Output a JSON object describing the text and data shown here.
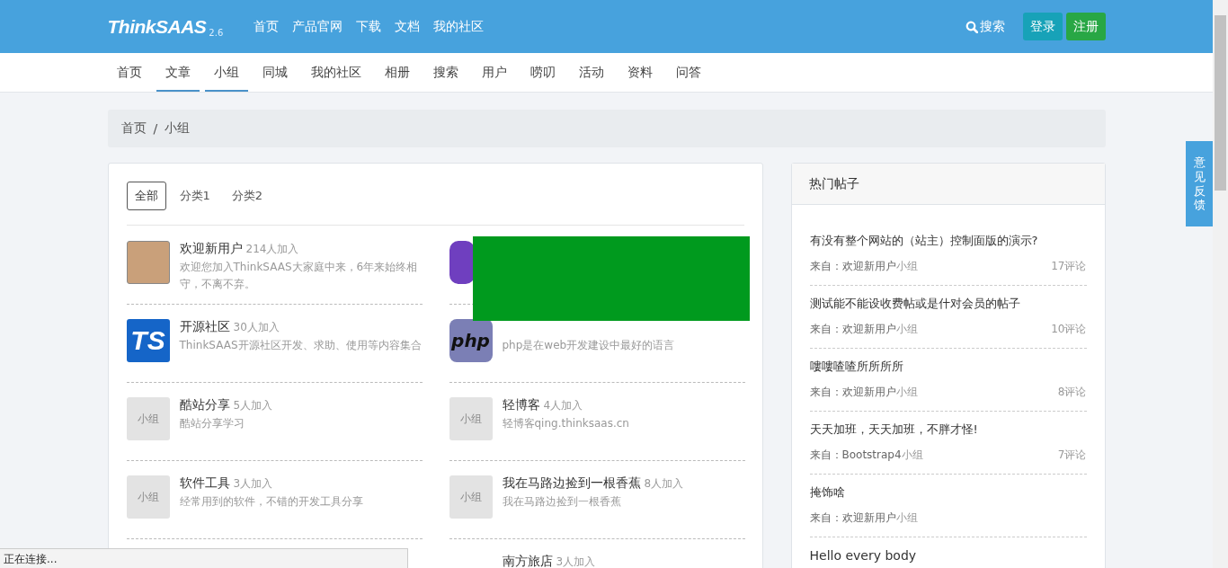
{
  "header": {
    "logo": "ThinkSAAS",
    "version": "2.6",
    "links": [
      "首页",
      "产品官网",
      "下载",
      "文档",
      "我的社区"
    ],
    "search": "搜索",
    "login": "登录",
    "register": "注册"
  },
  "nav": [
    {
      "label": "首页",
      "selected": false
    },
    {
      "label": "文章",
      "selected": true
    },
    {
      "label": "小组",
      "selected": true
    },
    {
      "label": "同城",
      "selected": false
    },
    {
      "label": "我的社区",
      "selected": false
    },
    {
      "label": "相册",
      "selected": false
    },
    {
      "label": "搜索",
      "selected": false
    },
    {
      "label": "用户",
      "selected": false
    },
    {
      "label": "唠叨",
      "selected": false
    },
    {
      "label": "活动",
      "selected": false
    },
    {
      "label": "资料",
      "selected": false
    },
    {
      "label": "问答",
      "selected": false
    }
  ],
  "breadcrumb": [
    "首页",
    "小组"
  ],
  "breadcrumb_separator": "/",
  "filters": [
    {
      "label": "全部",
      "selected": true
    },
    {
      "label": "分类1",
      "selected": false
    },
    {
      "label": "分类2",
      "selected": false
    }
  ],
  "groups": [
    {
      "kind": "photo",
      "name": "欢迎新用户",
      "count": "214人加入",
      "desc": "欢迎您加入ThinkSAAS大家庭中来，6年来始终相守，不离不弃。"
    },
    {
      "kind": "purple"
    },
    {
      "kind": "ts",
      "logo_text": "TS",
      "name": "开源社区",
      "count": "30人加入",
      "desc": "ThinkSAAS开源社区开发、求助、使用等内容集合"
    },
    {
      "kind": "php",
      "logo_text": "php",
      "desc": "php是在web开发建设中最好的语言"
    },
    {
      "kind": "placeholder",
      "placeholder_text": "小组",
      "name": "酷站分享",
      "count": "5人加入",
      "desc": "酷站分享学习"
    },
    {
      "kind": "placeholder",
      "placeholder_text": "小组",
      "name": "轻博客",
      "count": "4人加入",
      "desc": "轻博客qing.thinksaas.cn"
    },
    {
      "kind": "placeholder",
      "placeholder_text": "小组",
      "name": "软件工具",
      "count": "3人加入",
      "desc": "经常用到的软件，不错的开发工具分享"
    },
    {
      "kind": "placeholder",
      "placeholder_text": "小组",
      "name": "我在马路边捡到一根香蕉",
      "count": "8人加入",
      "desc": "我在马路边捡到一根香蕉"
    },
    {
      "kind": "none"
    },
    {
      "kind": "none",
      "name": "南方旅店",
      "count": "3人加入"
    }
  ],
  "hot": {
    "title": "热门帖子",
    "posts": [
      {
        "title": "有没有整个网站的（站主）控制面版的演示?",
        "from": "来自：欢迎新用户",
        "group": "小组",
        "comments": "17评论"
      },
      {
        "title": "测试能不能设收费帖或是什对会员的帖子",
        "from": "来自：欢迎新用户",
        "group": "小组",
        "comments": "10评论"
      },
      {
        "title": "嘍嘍喳喳所所所所",
        "from": "来自：欢迎新用户",
        "group": "小组",
        "comments": "8评论"
      },
      {
        "title": "天天加班，天天加班，不胖才怪!",
        "from": "来自：Bootstrap4",
        "group": "小组",
        "comments": "7评论"
      },
      {
        "title": "掩饰啥",
        "from": "来自：欢迎新用户",
        "group": "小组"
      },
      {
        "title": "Hello every body"
      }
    ]
  },
  "feedback": "意见反馈",
  "status_bar": "正在连接..."
}
